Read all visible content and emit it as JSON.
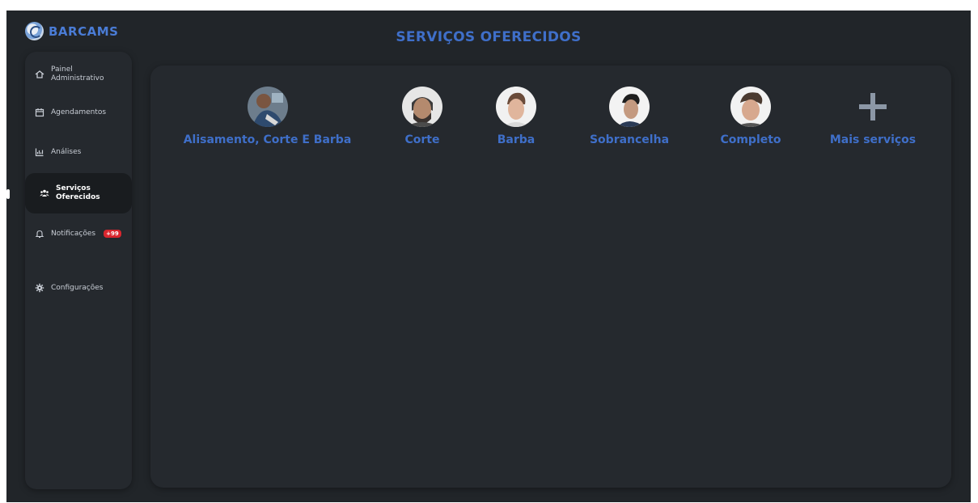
{
  "brand": {
    "name": "BARCAMS"
  },
  "page": {
    "title": "SERVIÇOS OFERECIDOS"
  },
  "sidebar": {
    "items": [
      {
        "label": "Painel Administrativo",
        "icon": "home-icon"
      },
      {
        "label": "Agendamentos",
        "icon": "calendar-icon"
      },
      {
        "label": "Análises",
        "icon": "chart-icon"
      },
      {
        "label": "Serviços Oferecidos",
        "icon": "users-icon",
        "active": true
      },
      {
        "label": "Notificações",
        "icon": "bell-icon",
        "badge": "+99"
      },
      {
        "label": "Configurações",
        "icon": "gear-icon"
      }
    ]
  },
  "services": [
    {
      "label": "Alisamento, Corte E Barba"
    },
    {
      "label": "Corte"
    },
    {
      "label": "Barba"
    },
    {
      "label": "Sobrancelha"
    },
    {
      "label": "Completo"
    },
    {
      "label": "Mais serviços",
      "icon": "plus-icon"
    }
  ],
  "colors": {
    "accent": "#3f6fc9",
    "background": "#212529",
    "panel": "#25292e",
    "badge": "#d9262e"
  }
}
